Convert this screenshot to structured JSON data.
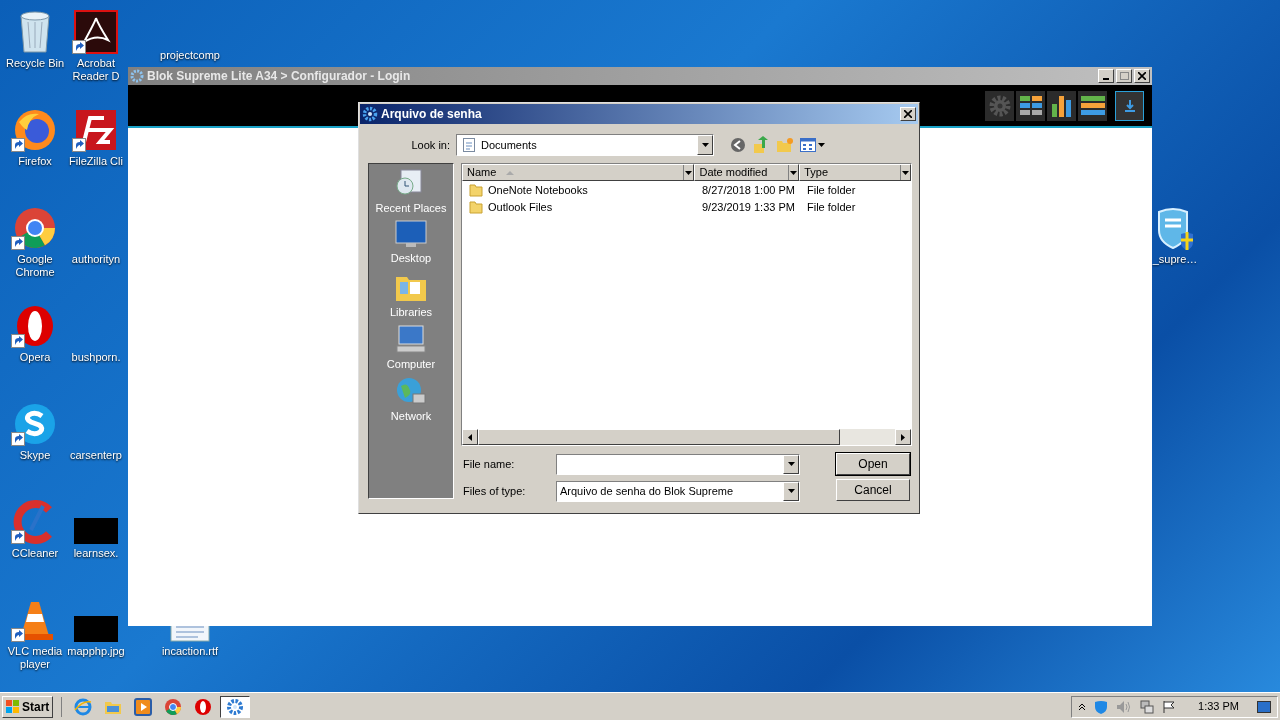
{
  "desktop_columns": [
    [
      {
        "label": "Recycle Bin",
        "kind": "recycle",
        "shortcut": false
      },
      {
        "label": "Firefox",
        "kind": "firefox",
        "shortcut": true
      },
      {
        "label": "Google Chrome",
        "kind": "chrome",
        "shortcut": true
      },
      {
        "label": "Opera",
        "kind": "opera",
        "shortcut": true
      },
      {
        "label": "Skype",
        "kind": "skype",
        "shortcut": true
      },
      {
        "label": "CCleaner",
        "kind": "ccleaner",
        "shortcut": true
      },
      {
        "label": "VLC media player",
        "kind": "vlc",
        "shortcut": true
      }
    ],
    [
      {
        "label": "Acrobat Reader D",
        "kind": "acrobat",
        "shortcut": true
      },
      {
        "label": "FileZilla Cli",
        "kind": "filezilla",
        "shortcut": true
      },
      {
        "label": "authorityn",
        "kind": "blank",
        "shortcut": false
      },
      {
        "label": "bushporn.",
        "kind": "blank",
        "shortcut": false
      },
      {
        "label": "carsenterp",
        "kind": "blank",
        "shortcut": false
      },
      {
        "label": "learnsex.",
        "kind": "blacked",
        "shortcut": false
      },
      {
        "label": "mapphp.jpg",
        "kind": "blacked",
        "shortcut": false
      }
    ],
    [
      {
        "label": "projectcomp",
        "kind": "blank",
        "shortcut": false
      },
      {
        "label": "incaction.rtf",
        "kind": "document",
        "shortcut": false
      }
    ]
  ],
  "right_icon": {
    "label": "_supre…",
    "kind": "shield",
    "shortcut": false
  },
  "app_window": {
    "title": "Blok Supreme Lite A34 > Configurador - Login",
    "toolbar": [
      {
        "kind": "gear",
        "selected": false
      },
      {
        "kind": "tiles",
        "selected": false
      },
      {
        "kind": "bars",
        "selected": false
      },
      {
        "kind": "list",
        "selected": false
      },
      {
        "kind": "download",
        "selected": true
      }
    ]
  },
  "dialog": {
    "title": "Arquivo de senha",
    "look_in": {
      "label": "Look in:",
      "value": "Documents"
    },
    "places": [
      {
        "label": "Recent Places",
        "kind": "recent"
      },
      {
        "label": "Desktop",
        "kind": "desktop"
      },
      {
        "label": "Libraries",
        "kind": "libraries"
      },
      {
        "label": "Computer",
        "kind": "computer"
      },
      {
        "label": "Network",
        "kind": "network"
      }
    ],
    "columns": [
      {
        "label": "Name",
        "sorted": true
      },
      {
        "label": "Date modified",
        "sorted": false
      },
      {
        "label": "Type",
        "sorted": false
      }
    ],
    "files": [
      {
        "name": "OneNote Notebooks",
        "date": "8/27/2018 1:00 PM",
        "type": "File folder"
      },
      {
        "name": "Outlook Files",
        "date": "9/23/2019 1:33 PM",
        "type": "File folder"
      }
    ],
    "file_name": {
      "label": "File name:"
    },
    "file_type": {
      "label": "Files of type:",
      "value": "Arquivo de senha do Blok Supreme"
    },
    "buttons": [
      {
        "label": "Open",
        "default": true
      },
      {
        "label": "Cancel",
        "default": false
      }
    ]
  },
  "taskbar": {
    "start": "Start",
    "items": [
      {
        "kind": "ie",
        "selected": false
      },
      {
        "kind": "explorer",
        "selected": false
      },
      {
        "kind": "media",
        "selected": false
      },
      {
        "kind": "chrome",
        "selected": false
      },
      {
        "kind": "opera",
        "selected": false
      },
      {
        "kind": "gear",
        "selected": true
      }
    ],
    "clock": "1:33 PM"
  }
}
